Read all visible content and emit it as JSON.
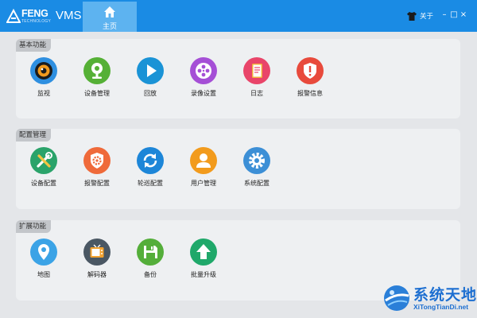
{
  "titlebar": {
    "logo_text": "FENG",
    "logo_subtext": "TECHNOLOGY",
    "app_name": "VMS",
    "home_tab_label": "主页",
    "about_label": "关于",
    "minimize_glyph": "–",
    "maximize_glyph": "□",
    "close_glyph": "×",
    "accent_color": "#1a8be4",
    "active_tab_color": "#5db3f0"
  },
  "sections": [
    {
      "title": "基本功能",
      "items": [
        {
          "label": "监视",
          "icon": "camera-lens-icon",
          "color": "#2e8fe0"
        },
        {
          "label": "设备管理",
          "icon": "webcam-icon",
          "color": "#55b036"
        },
        {
          "label": "回放",
          "icon": "play-icon",
          "color": "#1a93d6"
        },
        {
          "label": "录像设置",
          "icon": "film-reel-icon",
          "color": "#a54fd6"
        },
        {
          "label": "日志",
          "icon": "notebook-icon",
          "color": "#e9456a"
        },
        {
          "label": "报警信息",
          "icon": "alert-shield-icon",
          "color": "#e84a3c"
        }
      ]
    },
    {
      "title": "配置管理",
      "items": [
        {
          "label": "设备配置",
          "icon": "tools-icon",
          "color": "#2aa36a"
        },
        {
          "label": "报警配置",
          "icon": "gear-shield-icon",
          "color": "#ef6a3a"
        },
        {
          "label": "轮巡配置",
          "icon": "refresh-icon",
          "color": "#1d86d8"
        },
        {
          "label": "用户管理",
          "icon": "user-icon",
          "color": "#f29b1d"
        },
        {
          "label": "系统配置",
          "icon": "settings-icon",
          "color": "#3c8fd6"
        }
      ]
    },
    {
      "title": "扩展功能",
      "items": [
        {
          "label": "地图",
          "icon": "map-pin-icon",
          "color": "#3ba3e6"
        },
        {
          "label": "解码器",
          "icon": "tv-icon",
          "color": "#4a5763"
        },
        {
          "label": "备份",
          "icon": "floppy-icon",
          "color": "#54ae3a"
        },
        {
          "label": "批量升级",
          "icon": "upload-arrow-icon",
          "color": "#1fa86a"
        }
      ]
    }
  ],
  "watermark": {
    "cn_text": "系统天地",
    "en_text": "XiTongTianDi.net"
  }
}
